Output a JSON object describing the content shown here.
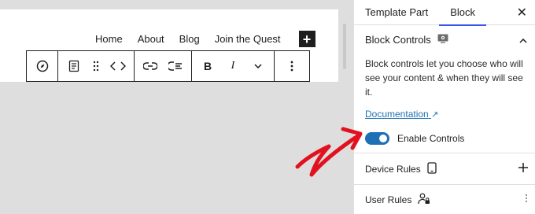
{
  "nav": {
    "items": [
      "Home",
      "About",
      "Blog",
      "Join the Quest"
    ],
    "add_symbol": "+"
  },
  "sidebar": {
    "tabs": [
      "Template Part",
      "Block"
    ],
    "active_tab": "Block",
    "close_symbol": "✕",
    "block_controls": {
      "title": "Block Controls",
      "description": "Block controls let you choose who will see your content & when they will see it.",
      "doc_link": "Documentation",
      "toggle_label": "Enable Controls",
      "toggle_on": true
    },
    "device_rules": "Device Rules",
    "user_rules": "User Rules"
  },
  "colors": {
    "accent": "#3858e9",
    "toggle": "#1e70b5",
    "link": "#2271b1",
    "arrow": "#e2111f"
  },
  "icons": [
    "compass-icon",
    "paragraph-icon",
    "drag-handle-icon",
    "move-arrows-icon",
    "link-icon",
    "list-icon",
    "bold-icon",
    "italic-icon",
    "chevron-down-icon",
    "more-options-icon",
    "eye-device-icon",
    "tablet-icon",
    "user-lock-icon",
    "plus-icon",
    "close-icon",
    "chevron-up-icon"
  ]
}
